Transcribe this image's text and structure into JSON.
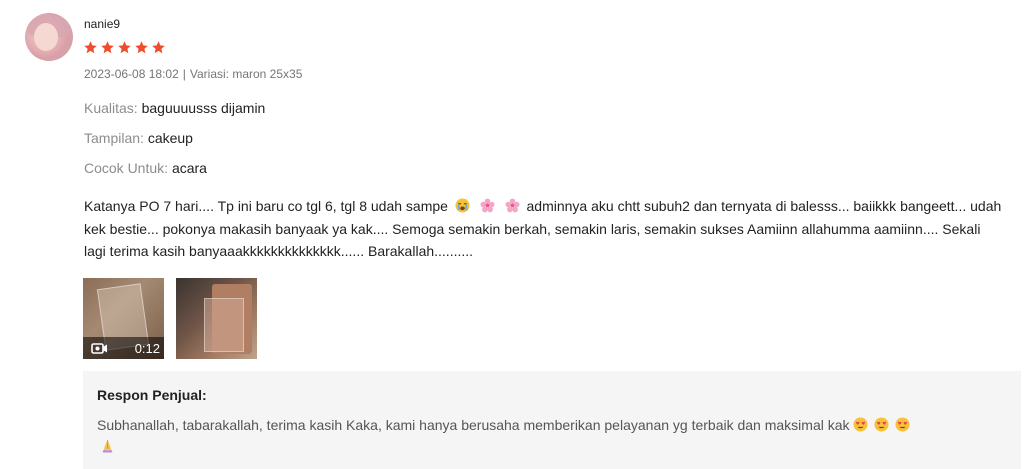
{
  "review": {
    "username": "nanie9",
    "rating": 5,
    "date": "2023-06-08 18:02",
    "separator": "|",
    "variation": "Variasi: maron 25x35",
    "attributes": [
      {
        "label": "Kualitas:",
        "value": "baguuuusss dijamin"
      },
      {
        "label": "Tampilan:",
        "value": "cakeup"
      },
      {
        "label": "Cocok Untuk:",
        "value": "acara"
      }
    ],
    "text_part1": "Katanya PO 7 hari.... Tp ini baru co tgl 6, tgl 8 udah sampe",
    "text_part2": "adminnya aku chtt subuh2 dan ternyata di balesss... baiikkk bangeett... udah kek bestie... pokonya makasih banyaak ya kak.... Semoga semakin berkah, semakin laris, semakin sukses Aamiinn allahumma aamiinn.... Sekali lagi terima kasih banyaaakkkkkkkkkkkkkk...... Barakallah..........",
    "media": [
      {
        "type": "video",
        "duration": "0:12",
        "icon": "video-camera-icon"
      },
      {
        "type": "image"
      }
    ]
  },
  "seller_response": {
    "title": "Respon Penjual:",
    "text": "Subhanallah, tabarakallah, terima kasih Kaka, kami hanya berusaha memberikan pelayanan yg terbaik dan maksimal kak"
  },
  "colors": {
    "star": "#ee4d2d",
    "muted": "#757575",
    "response_bg": "#f5f5f5"
  }
}
